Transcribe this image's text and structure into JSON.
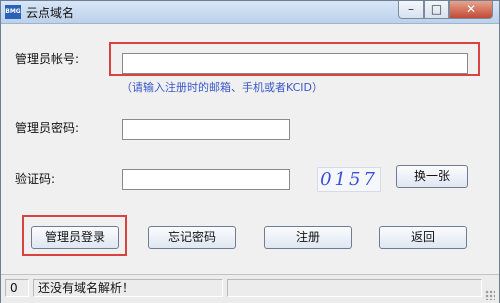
{
  "window": {
    "title": "云点域名",
    "app_icon_label": "BMG",
    "controls": {
      "minimize": "–",
      "maximize": "□",
      "close": "✕"
    }
  },
  "form": {
    "admin_account": {
      "label": "管理员帐号:",
      "value": "",
      "hint": "（请输入注册时的邮箱、手机或者KCID）"
    },
    "admin_password": {
      "label": "管理员密码:",
      "value": ""
    },
    "captcha": {
      "label": "验证码:",
      "value": "",
      "image_text": "0157",
      "refresh_button": "换一张"
    }
  },
  "actions": {
    "login": "管理员登录",
    "forgot_password": "忘记密码",
    "register": "注册",
    "back": "返回"
  },
  "statusbar": {
    "count": "0",
    "message": "还没有域名解析！"
  },
  "annotation": {
    "color": "#d9423e"
  }
}
